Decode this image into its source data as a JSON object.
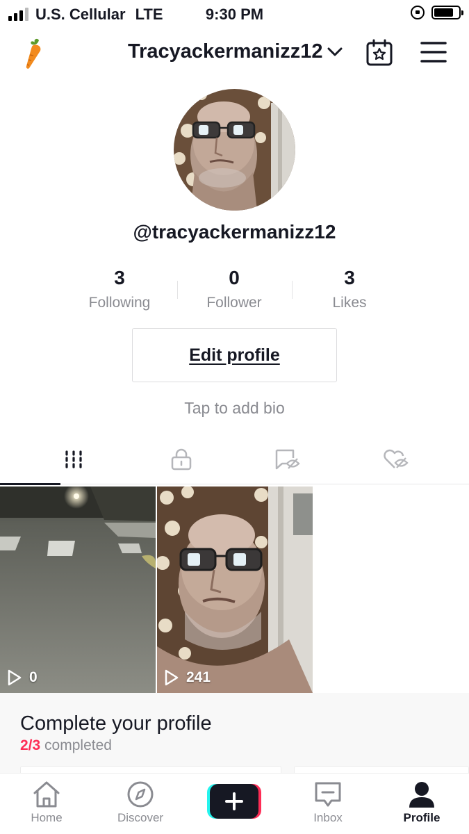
{
  "status_bar": {
    "carrier": "U.S. Cellular",
    "network": "LTE",
    "time": "9:30 PM",
    "battery_level": 0.8,
    "signal_bars": 3
  },
  "header": {
    "username": "Tracyackermanizz12"
  },
  "profile": {
    "handle": "@tracyackermanizz12",
    "stats": [
      {
        "value": "3",
        "label": "Following"
      },
      {
        "value": "0",
        "label": "Follower"
      },
      {
        "value": "3",
        "label": "Likes"
      }
    ],
    "edit_label": "Edit profile",
    "bio_placeholder": "Tap to add bio"
  },
  "tabs": [
    {
      "icon": "grid-icon",
      "active": true
    },
    {
      "icon": "lock-icon",
      "active": false
    },
    {
      "icon": "tagged-hidden-icon",
      "active": false
    },
    {
      "icon": "liked-hidden-icon",
      "active": false
    }
  ],
  "videos": [
    {
      "views": "0",
      "thumbnail": "night-road"
    },
    {
      "views": "241",
      "thumbnail": "selfie"
    }
  ],
  "complete_profile": {
    "title": "Complete your profile",
    "progress": "2/3",
    "suffix": "completed"
  },
  "bottom_nav": [
    {
      "label": "Home",
      "icon": "home-icon"
    },
    {
      "label": "Discover",
      "icon": "compass-icon"
    },
    {
      "label": "",
      "icon": "plus-icon"
    },
    {
      "label": "Inbox",
      "icon": "inbox-icon"
    },
    {
      "label": "Profile",
      "icon": "profile-icon",
      "active": true
    }
  ],
  "colors": {
    "accent": "#fe2c55",
    "accent_cyan": "#25f4ee",
    "text": "#161823",
    "muted": "#8a8b91"
  }
}
